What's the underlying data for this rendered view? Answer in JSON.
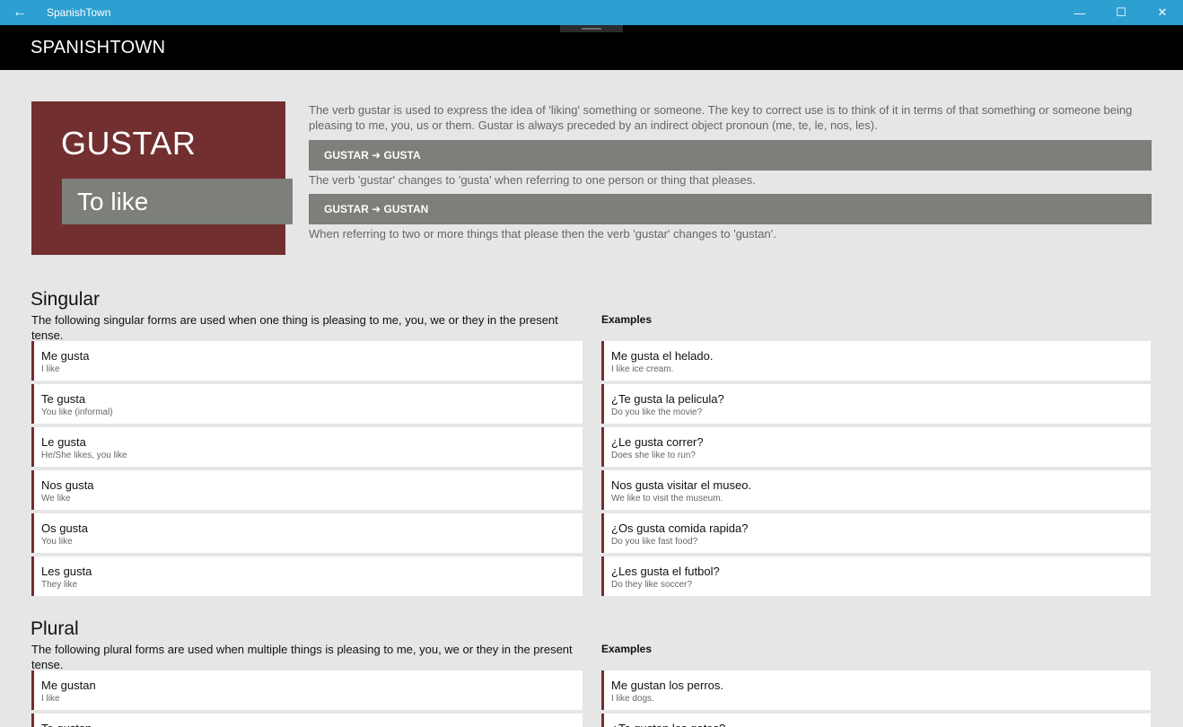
{
  "window": {
    "title": "SpanishTown",
    "back_glyph": "←",
    "min_glyph": "—",
    "max_glyph": "☐",
    "close_glyph": "✕"
  },
  "app": {
    "brand": "SPANISHTOWN"
  },
  "hero": {
    "word": "GUSTAR",
    "meaning": "To like",
    "accent": "#722f30"
  },
  "intro": {
    "text": "The verb gustar is used to express the idea of 'liking' something or someone.  The key to correct use is to think of it in terms of that something or someone being pleasing to me, you, us or them.  Gustar is always preceded by an indirect object pronoun (me, te, le, nos, les).",
    "rules": [
      {
        "label": "GUSTAR ➜ GUSTA",
        "note": "The verb 'gustar' changes to 'gusta' when referring to one person or thing that pleases."
      },
      {
        "label": "GUSTAR ➜ GUSTAN",
        "note": "When referring to two or more things that please then the verb 'gustar' changes to 'gustan'."
      }
    ]
  },
  "singular": {
    "title": "Singular",
    "description": "The following singular forms are used when one thing is pleasing to me, you, we or they in the present tense.",
    "examples_label": "Examples",
    "forms": [
      {
        "primary": "Me gusta",
        "secondary": "I like"
      },
      {
        "primary": "Te gusta",
        "secondary": "You like (informal)"
      },
      {
        "primary": "Le gusta",
        "secondary": "He/She likes, you like"
      },
      {
        "primary": "Nos gusta",
        "secondary": "We like"
      },
      {
        "primary": "Os gusta",
        "secondary": "You like"
      },
      {
        "primary": "Les gusta",
        "secondary": "They like"
      }
    ],
    "examples": [
      {
        "primary": "Me gusta el helado.",
        "secondary": "I like ice cream."
      },
      {
        "primary": "¿Te gusta la pelicula?",
        "secondary": "Do you like the movie?"
      },
      {
        "primary": "¿Le gusta correr?",
        "secondary": "Does she like to run?"
      },
      {
        "primary": "Nos gusta visitar el museo.",
        "secondary": "We like to visit the museum."
      },
      {
        "primary": "¿Os gusta comida rapida?",
        "secondary": "Do you like fast food?"
      },
      {
        "primary": "¿Les gusta el futbol?",
        "secondary": "Do they like soccer?"
      }
    ]
  },
  "plural": {
    "title": "Plural",
    "description": "The following plural forms are used when multiple things is pleasing to me, you, we or they in the present tense.",
    "examples_label": "Examples",
    "forms": [
      {
        "primary": "Me gustan",
        "secondary": "I like"
      },
      {
        "primary": "Te gustan",
        "secondary": ""
      }
    ],
    "examples": [
      {
        "primary": "Me gustan los perros.",
        "secondary": "I like dogs."
      },
      {
        "primary": "¿Te gustan los gatos?",
        "secondary": ""
      }
    ]
  }
}
